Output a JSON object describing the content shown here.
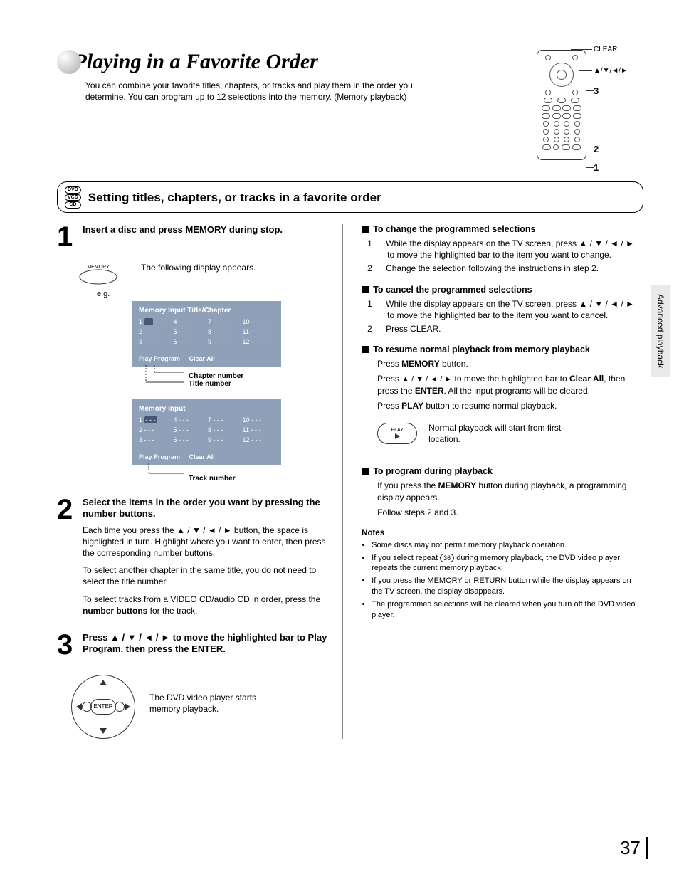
{
  "page": {
    "title": "Playing in a Favorite Order",
    "intro": "You can combine your favorite titles, chapters, or tracks and play them in the order you determine. You can program up to 12 selections into the memory. (Memory playback)",
    "section_title": "Setting titles, chapters, or tracks in a favorite order",
    "side_tab": "Advanced playback",
    "number": "37"
  },
  "disc_types": [
    "DVD",
    "VCD",
    "CD"
  ],
  "remote_labels": {
    "clear": "CLEAR",
    "arrows": "▲/▼/◄/►",
    "l3": "3",
    "l2": "2",
    "l1": "1"
  },
  "steps": {
    "s1": {
      "num": "1",
      "title": "Insert a disc and press MEMORY during stop.",
      "caption": "The following display appears.",
      "memory_label": "MEMORY",
      "eg": "e.g."
    },
    "s2": {
      "num": "2",
      "title": "Select the items in the order you want by pressing the number buttons.",
      "p1": "Each time you press the ▲ / ▼ / ◄ / ► button, the space is highlighted in turn. Highlight where you want to enter, then press the corresponding number buttons.",
      "p2": "To select another chapter in the same title, you do not need to select the title number.",
      "p3": "To select tracks from a VIDEO CD/audio CD in order, press the number buttons for the track."
    },
    "s3": {
      "num": "3",
      "title": "Press ▲ / ▼ / ◄ / ► to move the highlighted bar to Play Program, then press the ENTER.",
      "body": "The DVD video player starts memory playback.",
      "enter_label": "ENTER"
    }
  },
  "osd1": {
    "title": "Memory Input   Title/Chapter",
    "cells": [
      "1 - - - -",
      "4 - - - -",
      "7 - - - -",
      "10 - - - -",
      "2 - - - -",
      "5 - - - -",
      "8 - - - -",
      "11 - - - -",
      "3 - - - -",
      "6 - - - -",
      "9 - - - -",
      "12 - - - -"
    ],
    "play": "Play Program",
    "clear": "Clear All",
    "cap1": "Chapter number",
    "cap2": "Title number"
  },
  "osd2": {
    "title": "Memory Input",
    "cells": [
      "1 - - -",
      "4 - - -",
      "7 - - -",
      "10 - - -",
      "2 - - -",
      "5 - - -",
      "8 - - -",
      "11 - - -",
      "3 - - -",
      "6 - - -",
      "9 - - -",
      "12 - - -"
    ],
    "play": "Play Program",
    "clear": "Clear All",
    "cap1": "Track number"
  },
  "right": {
    "change_h": "To change the programmed selections",
    "change_1": "While the display appears on the TV screen, press ▲ / ▼ / ◄ / ► to move the highlighted bar to the item you want to change.",
    "change_2": "Change the selection following the instructions in step 2.",
    "cancel_h": "To cancel the programmed selections",
    "cancel_1": "While the display appears on the TV screen, press ▲ / ▼ / ◄ / ► to move the highlighted bar to the item you want to cancel.",
    "cancel_2": "Press CLEAR.",
    "resume_h": "To resume normal playback from memory playback",
    "resume_1": "Press MEMORY button.",
    "resume_2": "Press ▲ / ▼ / ◄ / ► to move the highlighted bar to Clear All, then press the ENTER. All the input programs will be cleared.",
    "resume_3": "Press PLAY button to resume normal playback.",
    "play_label": "PLAY",
    "play_note": "Normal playback will start from first location.",
    "prog_h": "To program during playback",
    "prog_1": "If you press the MEMORY button during playback, a programming display appears.",
    "prog_2": "Follow steps 2 and 3.",
    "notes_h": "Notes",
    "notes": [
      "Some discs may not permit memory playback operation.",
      "If you select repeat 36 during memory playback, the DVD video player repeats the current memory playback.",
      "If you press the MEMORY or RETURN button while the display appears on the TV screen, the display disappears.",
      "The programmed selections will be cleared when you turn off the DVD video player."
    ]
  }
}
